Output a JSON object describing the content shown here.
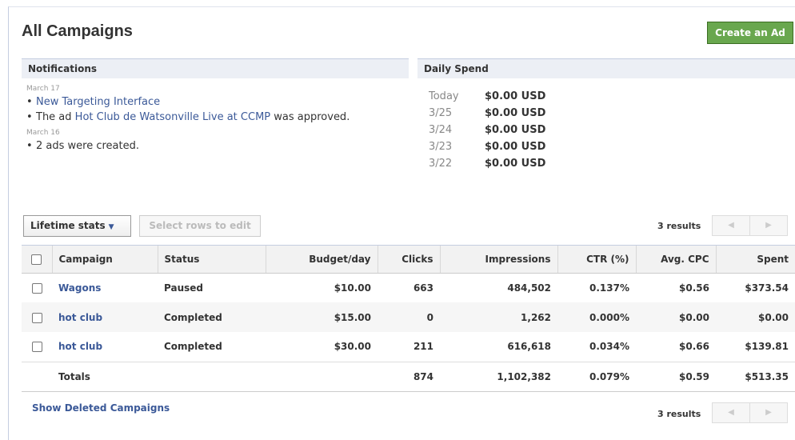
{
  "page_title": "All Campaigns",
  "create_ad_label": "Create an Ad",
  "notifications": {
    "header": "Notifications",
    "groups": [
      {
        "date": "March 17",
        "items": [
          {
            "prefix": "",
            "link": "New Targeting Interface",
            "suffix": ""
          },
          {
            "prefix": "The ad ",
            "link": "Hot Club de Watsonville Live at CCMP",
            "suffix": " was approved."
          }
        ]
      },
      {
        "date": "March 16",
        "items": [
          {
            "prefix": "2 ads were created.",
            "link": "",
            "suffix": ""
          }
        ]
      }
    ]
  },
  "daily_spend": {
    "header": "Daily Spend",
    "rows": [
      {
        "day": "Today",
        "amount": "$0.00 USD"
      },
      {
        "day": "3/25",
        "amount": "$0.00 USD"
      },
      {
        "day": "3/24",
        "amount": "$0.00 USD"
      },
      {
        "day": "3/23",
        "amount": "$0.00 USD"
      },
      {
        "day": "3/22",
        "amount": "$0.00 USD"
      }
    ]
  },
  "toolbar": {
    "stats_label": "Lifetime stats",
    "stats_arrow": "▼",
    "edit_label": "Select rows to edit",
    "results_label": "3 results",
    "prev_glyph": "◀",
    "next_glyph": "▶"
  },
  "table": {
    "columns": [
      "Campaign",
      "Status",
      "Budget/day",
      "Clicks",
      "Impressions",
      "CTR (%)",
      "Avg. CPC",
      "Spent"
    ],
    "rows": [
      {
        "campaign": "Wagons",
        "status": "Paused",
        "budget": "$10.00",
        "clicks": "663",
        "impressions": "484,502",
        "ctr": "0.137%",
        "cpc": "$0.56",
        "spent": "$373.54"
      },
      {
        "campaign": "hot club",
        "status": "Completed",
        "budget": "$15.00",
        "clicks": "0",
        "impressions": "1,262",
        "ctr": "0.000%",
        "cpc": "$0.00",
        "spent": "$0.00"
      },
      {
        "campaign": "hot club",
        "status": "Completed",
        "budget": "$30.00",
        "clicks": "211",
        "impressions": "616,618",
        "ctr": "0.034%",
        "cpc": "$0.66",
        "spent": "$139.81"
      }
    ],
    "totals": {
      "label": "Totals",
      "clicks": "874",
      "impressions": "1,102,382",
      "ctr": "0.079%",
      "cpc": "$0.59",
      "spent": "$513.35"
    }
  },
  "footer": {
    "show_deleted_label": "Show Deleted Campaigns",
    "results_label": "3 results"
  },
  "colors": {
    "link": "#3b5998",
    "create_button": "#69a74e",
    "header_bg": "#eceff5"
  }
}
